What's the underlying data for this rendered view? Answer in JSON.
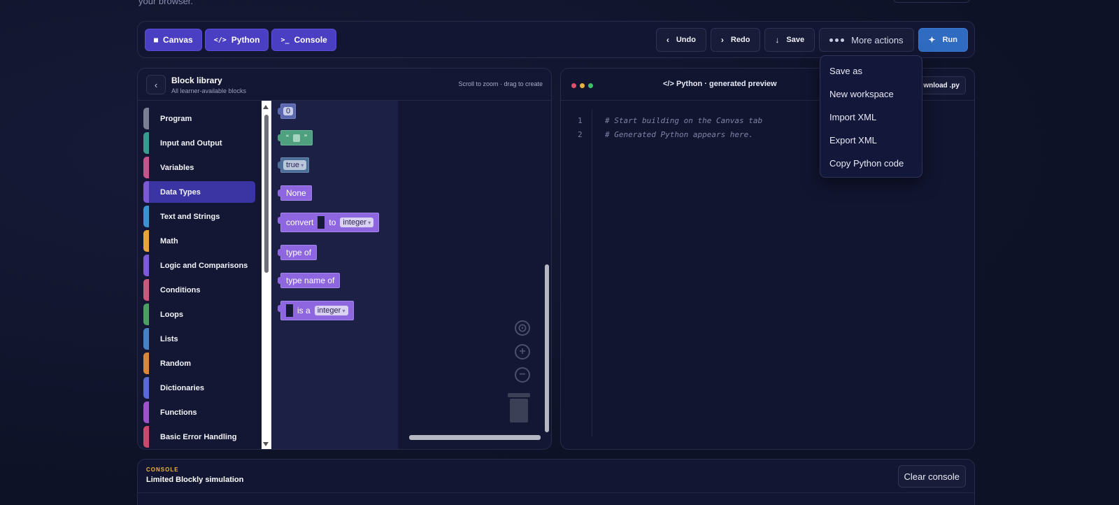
{
  "page": {
    "top_text": "your browser."
  },
  "toolbar": {
    "tabs": [
      {
        "icon": "canvas-icon",
        "glyph": "■",
        "label": "Canvas"
      },
      {
        "icon": "code-icon",
        "glyph": "</>",
        "label": "Python"
      },
      {
        "icon": "terminal-icon",
        "glyph": ">_",
        "label": "Console"
      }
    ],
    "undo": {
      "glyph": "‹",
      "label": "Undo"
    },
    "redo": {
      "glyph": "›",
      "label": "Redo"
    },
    "save": {
      "glyph": "↓",
      "label": "Save"
    },
    "more": {
      "label": "More actions"
    },
    "run": {
      "glyph": "✦",
      "label": "Run"
    }
  },
  "library": {
    "back_glyph": "‹",
    "title": "Block library",
    "subtitle": "All learner-available blocks",
    "hint": "Scroll to zoom · drag to create",
    "categories": [
      {
        "label": "Program",
        "color": "#7a7f95"
      },
      {
        "label": "Input and Output",
        "color": "#3b9a8e"
      },
      {
        "label": "Variables",
        "color": "#c4558a"
      },
      {
        "label": "Data Types",
        "color": "#7c5ad6"
      },
      {
        "label": "Text and Strings",
        "color": "#3f8fd1"
      },
      {
        "label": "Math",
        "color": "#e2a93a"
      },
      {
        "label": "Logic and Comparisons",
        "color": "#7c5ad6"
      },
      {
        "label": "Conditions",
        "color": "#c85a7c"
      },
      {
        "label": "Loops",
        "color": "#4d9e62"
      },
      {
        "label": "Lists",
        "color": "#4681c2"
      },
      {
        "label": "Random",
        "color": "#d6883a"
      },
      {
        "label": "Dictionaries",
        "color": "#5a6ad0"
      },
      {
        "label": "Functions",
        "color": "#9c52c8"
      },
      {
        "label": "Basic Error Handling",
        "color": "#c94a6a"
      }
    ],
    "selected_category": "Data Types",
    "blocks": {
      "number": "0",
      "quote_open": "“",
      "quote_close": "”",
      "boolean": "true",
      "none": "None",
      "convert": "convert",
      "to": "to",
      "convert_type": "integer",
      "type_of": "type of",
      "type_name_of": "type name of",
      "is_a": "is a",
      "is_a_type": "integer"
    },
    "controls": {
      "recenter": "⊙",
      "zoom_in": "+",
      "zoom_out": "−"
    }
  },
  "python": {
    "title": "</> Python · generated preview",
    "download": "wnload .py",
    "traffic_colors": [
      "#e0506a",
      "#e7b33b",
      "#3cc06a"
    ],
    "lines": [
      {
        "n": "1",
        "text": "# Start building on the Canvas tab"
      },
      {
        "n": "2",
        "text": "# Generated Python appears here."
      }
    ]
  },
  "menu": {
    "items": [
      "Save as",
      "New workspace",
      "Import XML",
      "Export XML",
      "Copy Python code"
    ]
  },
  "console": {
    "eyebrow": "CONSOLE",
    "title": "Limited Blockly simulation",
    "clear": "Clear console"
  }
}
